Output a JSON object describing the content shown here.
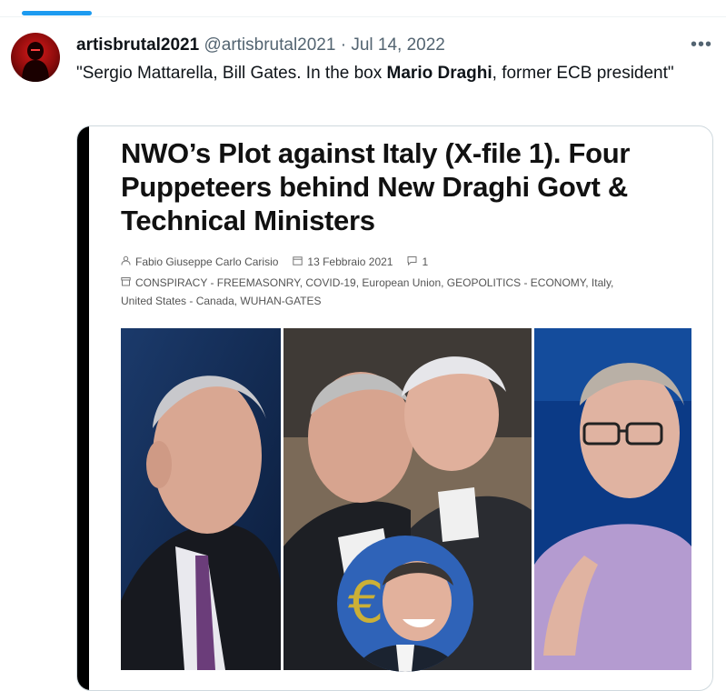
{
  "tweet": {
    "author_name": "artisbrutal2021",
    "handle": "@artisbrutal2021",
    "separator": "·",
    "date": "Jul 14, 2022",
    "more_icon": "•••",
    "text_before": "\"Sergio Mattarella, Bill Gates. In the box ",
    "text_bold": "Mario Draghi",
    "text_after": ", former ECB president\""
  },
  "article": {
    "title": "NWO’s Plot against Italy (X-file 1). Four Puppeteers behind New Draghi Govt & Technical Ministers",
    "author": "Fabio Giuseppe Carlo Carisio",
    "date": "13 Febbraio 2021",
    "comments": "1",
    "categories": "CONSPIRACY - FREEMASONRY, COVID-19, European Union, GEOPOLITICS - ECONOMY, Italy, United States - Canada, WUHAN-GATES"
  },
  "icons": {
    "more": "more-horizontal-icon",
    "author": "user-icon",
    "date": "calendar-icon",
    "comments": "comment-icon",
    "categories": "folder-icon"
  },
  "colors": {
    "accent": "#1d9bf0",
    "text": "#0f1419",
    "secondary": "#536471",
    "card_border": "#cfd9de"
  }
}
